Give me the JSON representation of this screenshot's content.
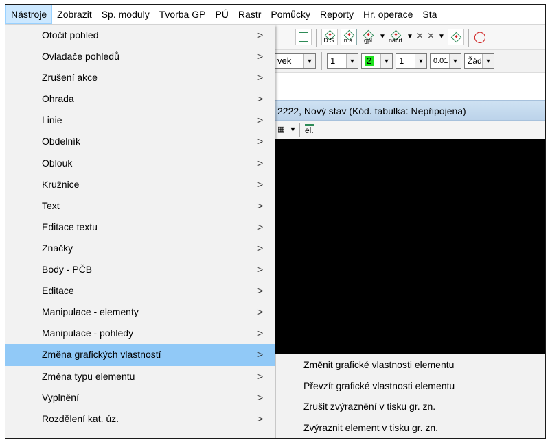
{
  "menubar": {
    "items": [
      "Nástroje",
      "Zobrazit",
      "Sp. moduly",
      "Tvorba GP",
      "PÚ",
      "Rastr",
      "Pomůcky",
      "Reporty",
      "Hr. operace",
      "Sta"
    ]
  },
  "toolbar": {
    "buttons": [
      "D.S.",
      "n.s.",
      "gpl",
      "náčrt"
    ]
  },
  "toolbar2": {
    "combo_1": "vek",
    "combo_2": "1",
    "combo_3": "2",
    "combo_4": "1",
    "combo_5": "0.01",
    "combo_6": "Žádn"
  },
  "document": {
    "title": "2222, Nový stav (Kód. tabulka: Nepřipojena)",
    "small_toolbar_label": "el."
  },
  "menu": {
    "items": [
      "Otočit pohled",
      "Ovladače pohledů",
      "Zrušení akce",
      "Ohrada",
      "Linie",
      "Obdelník",
      "Oblouk",
      "Kružnice",
      "Text",
      "Editace textu",
      "Značky",
      "Body - PČB",
      "Editace",
      "Manipulace - elementy",
      "Manipulace - pohledy",
      "Změna grafických vlastností",
      "Změna typu elementu",
      "Vyplnění",
      "Rozdělení kat. úz."
    ],
    "submenu_arrow": ">"
  },
  "submenu": {
    "items": [
      "Změnit grafické vlastnosti elementu",
      "Převzít grafické vlastnosti elementu",
      "Zrušit zvýraznění v tisku gr. zn.",
      "Zvýraznit element v tisku gr. zn."
    ]
  },
  "colors": {
    "menu_bg": "#f2f2f2",
    "highlight": "#91c9f7",
    "title_bar": "#c6dbef",
    "canvas": "#000000"
  }
}
